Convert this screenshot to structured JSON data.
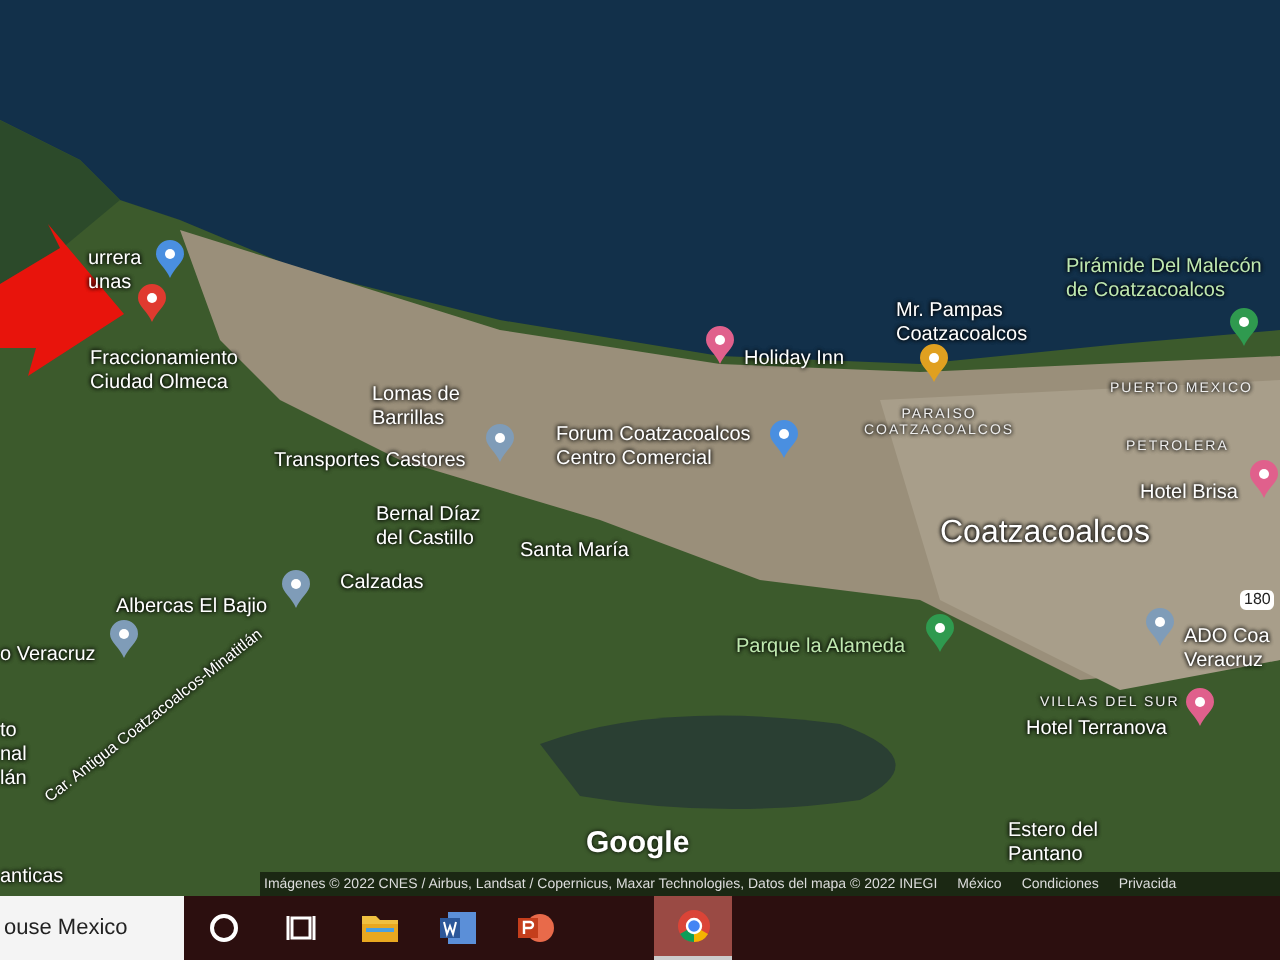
{
  "map": {
    "labels": [
      {
        "kind": "place",
        "lines": [
          "urrera",
          "unas"
        ],
        "color": "#4a8fe0"
      },
      {
        "kind": "place",
        "lines": [
          "Fraccionamiento",
          "Ciudad Olmeca"
        ],
        "color": "#e03a2f"
      },
      {
        "kind": "place",
        "lines": [
          "Lomas de",
          "Barrillas"
        ]
      },
      {
        "kind": "place",
        "lines": [
          "Transportes Castores"
        ],
        "color": "#7f9cb8"
      },
      {
        "kind": "place",
        "lines": [
          "Bernal Díaz",
          "del Castillo"
        ]
      },
      {
        "kind": "place",
        "lines": [
          "Santa María"
        ]
      },
      {
        "kind": "place",
        "lines": [
          "Calzadas"
        ]
      },
      {
        "kind": "place",
        "lines": [
          "Albercas El Bajio"
        ],
        "color": "#7f9cb8"
      },
      {
        "kind": "place",
        "lines": [
          "o Veracruz"
        ],
        "color": "#7f9cb8"
      },
      {
        "kind": "place",
        "lines": [
          "to",
          "nal",
          "lán"
        ]
      },
      {
        "kind": "road",
        "lines": [
          "Car. Antigua Coatzacoalcos-Minatitlán"
        ]
      },
      {
        "kind": "place",
        "lines": [
          "anticas"
        ]
      },
      {
        "kind": "place",
        "lines": [
          "Holiday Inn"
        ],
        "color": "#e0608c"
      },
      {
        "kind": "place",
        "lines": [
          "Mr. Pampas",
          "Coatzacoalcos"
        ],
        "color": "#e0a020"
      },
      {
        "kind": "district",
        "lines": [
          "PARAISO",
          "COATZACOALCOS"
        ]
      },
      {
        "kind": "place",
        "lines": [
          "Forum Coatzacoalcos",
          "Centro Comercial"
        ],
        "color": "#4a8fe0"
      },
      {
        "kind": "park",
        "lines": [
          "Pirámide Del Malecón",
          "de Coatzacoalcos"
        ],
        "color": "#2f9a4f"
      },
      {
        "kind": "district",
        "lines": [
          "PUERTO MEXICO"
        ]
      },
      {
        "kind": "district",
        "lines": [
          "PETROLERA"
        ]
      },
      {
        "kind": "place",
        "lines": [
          "Hotel Brisa"
        ],
        "color": "#e0608c"
      },
      {
        "kind": "city",
        "lines": [
          "Coatzacoalcos"
        ]
      },
      {
        "kind": "shield",
        "lines": [
          "180"
        ]
      },
      {
        "kind": "park",
        "lines": [
          "Parque la Alameda"
        ],
        "color": "#2f9a4f"
      },
      {
        "kind": "place",
        "lines": [
          "ADO Coa",
          "Veracruz"
        ],
        "color": "#7f9cb8"
      },
      {
        "kind": "district",
        "lines": [
          "VILLAS DEL SUR"
        ]
      },
      {
        "kind": "place",
        "lines": [
          "Hotel Terranova"
        ],
        "color": "#e0608c"
      },
      {
        "kind": "place",
        "lines": [
          "Estero del",
          "Pantano"
        ]
      }
    ],
    "logo": "Google",
    "attribution": [
      "Imágenes © 2022 CNES / Airbus, Landsat / Copernicus, Maxar Technologies, Datos del mapa © 2022 INEGI",
      "México",
      "Condiciones",
      "Privacida"
    ]
  },
  "taskbar": {
    "search": "ouse Mexico",
    "apps": [
      {
        "kind": "cortana",
        "selected": false
      },
      {
        "kind": "taskview",
        "selected": false
      },
      {
        "kind": "explorer",
        "selected": false
      },
      {
        "kind": "word",
        "selected": false
      },
      {
        "kind": "powerpoint",
        "selected": false
      },
      {
        "kind": "chrome",
        "selected": true
      }
    ]
  }
}
